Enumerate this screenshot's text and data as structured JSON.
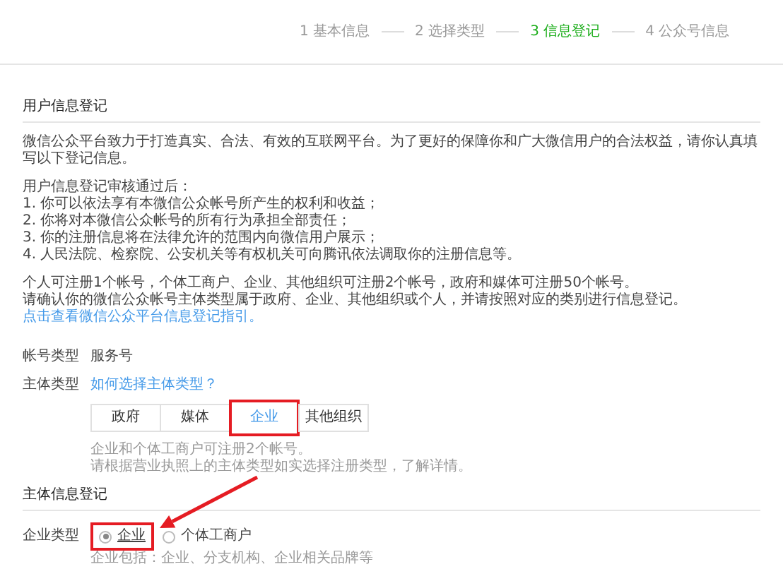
{
  "steps": [
    {
      "label": "1 基本信息",
      "selected": false
    },
    {
      "label": "2 选择类型",
      "selected": false
    },
    {
      "label": "3 信息登记",
      "selected": true
    },
    {
      "label": "4 公众号信息",
      "selected": false
    }
  ],
  "user_section": {
    "title": "用户信息登记",
    "intro": "微信公众平台致力于打造真实、合法、有效的互联网平台。为了更好的保障你和广大微信用户的合法权益，请你认真填写以下登记信息。",
    "list_title": "用户信息登记审核通过后：",
    "items": [
      "1. 你可以依法享有本微信公众帐号所产生的权利和收益；",
      "2. 你将对本微信公众帐号的所有行为承担全部责任；",
      "3. 你的注册信息将在法律允许的范围内向微信用户展示；",
      "4. 人民法院、检察院、公安机关等有权机关可向腾讯依法调取你的注册信息等。"
    ],
    "notes": [
      "个人可注册1个帐号，个体工商户、企业、其他组织可注册2个帐号，政府和媒体可注册50个帐号。",
      "请确认你的微信公众帐号主体类型属于政府、企业、其他组织或个人，并请按照对应的类别进行信息登记。"
    ],
    "guide_link": "点击查看微信公众平台信息登记指引。"
  },
  "account_type": {
    "label": "帐号类型",
    "value": "服务号"
  },
  "subject_type": {
    "label": "主体类型",
    "help_link": "如何选择主体类型？",
    "options": [
      {
        "label": "政府",
        "selected": false,
        "highlighted": false
      },
      {
        "label": "媒体",
        "selected": false,
        "highlighted": false
      },
      {
        "label": "企业",
        "selected": true,
        "highlighted": true
      },
      {
        "label": "其他组织",
        "selected": false,
        "highlighted": false
      }
    ],
    "hints": [
      "企业和个体工商户可注册2个帐号。",
      "请根据营业执照上的主体类型如实选择注册类型，了解详情。"
    ]
  },
  "subject_section": {
    "title": "主体信息登记",
    "enterprise_type": {
      "label": "企业类型",
      "options": [
        {
          "label": "企业",
          "selected": true,
          "highlighted": true
        },
        {
          "label": "个体工商户",
          "selected": false,
          "highlighted": false
        }
      ],
      "hint": "企业包括：企业、分支机构、企业相关品牌等"
    }
  }
}
